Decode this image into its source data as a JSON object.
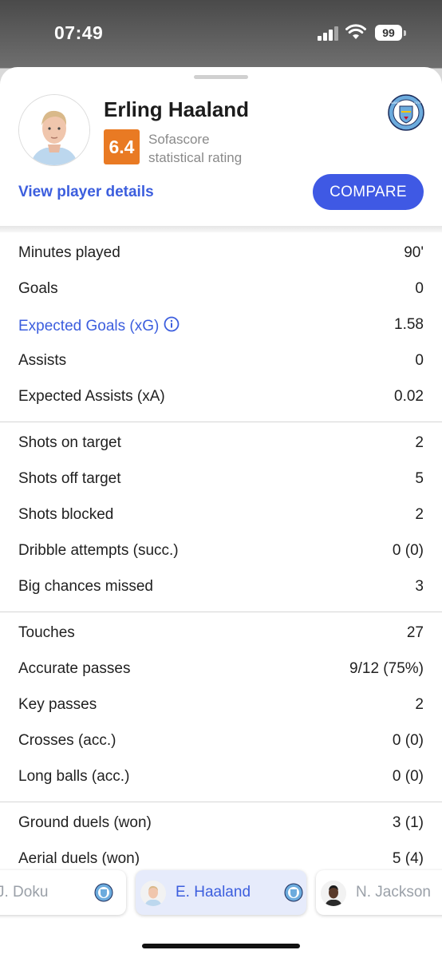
{
  "status": {
    "time": "07:49",
    "battery": "99"
  },
  "player": {
    "name": "Erling Haaland",
    "rating": "6.4",
    "rating_label_line1": "Sofascore",
    "rating_label_line2": "statistical rating",
    "view_details": "View player details",
    "compare": "COMPARE",
    "team_crest_text": "MANCHESTER CITY"
  },
  "stat_groups": [
    [
      {
        "label": "Minutes played",
        "value": "90'"
      },
      {
        "label": "Goals",
        "value": "0"
      },
      {
        "label": "Expected Goals (xG)",
        "value": "1.58",
        "link": true
      },
      {
        "label": "Assists",
        "value": "0"
      },
      {
        "label": "Expected Assists (xA)",
        "value": "0.02"
      }
    ],
    [
      {
        "label": "Shots on target",
        "value": "2"
      },
      {
        "label": "Shots off target",
        "value": "5"
      },
      {
        "label": "Shots blocked",
        "value": "2"
      },
      {
        "label": "Dribble attempts (succ.)",
        "value": "0 (0)"
      },
      {
        "label": "Big chances missed",
        "value": "3"
      }
    ],
    [
      {
        "label": "Touches",
        "value": "27"
      },
      {
        "label": "Accurate passes",
        "value": "9/12 (75%)"
      },
      {
        "label": "Key passes",
        "value": "2"
      },
      {
        "label": "Crosses (acc.)",
        "value": "0 (0)"
      },
      {
        "label": "Long balls (acc.)",
        "value": "0 (0)"
      }
    ],
    [
      {
        "label": "Ground duels (won)",
        "value": "3 (1)"
      },
      {
        "label": "Aerial duels (won)",
        "value": "5 (4)"
      }
    ]
  ],
  "switcher": {
    "prev": "J. Doku",
    "current": "E. Haaland",
    "next": "N. Jackson"
  },
  "colors": {
    "accent": "#3f59e4",
    "link": "#3c5ede",
    "rating": "#e97a23"
  }
}
